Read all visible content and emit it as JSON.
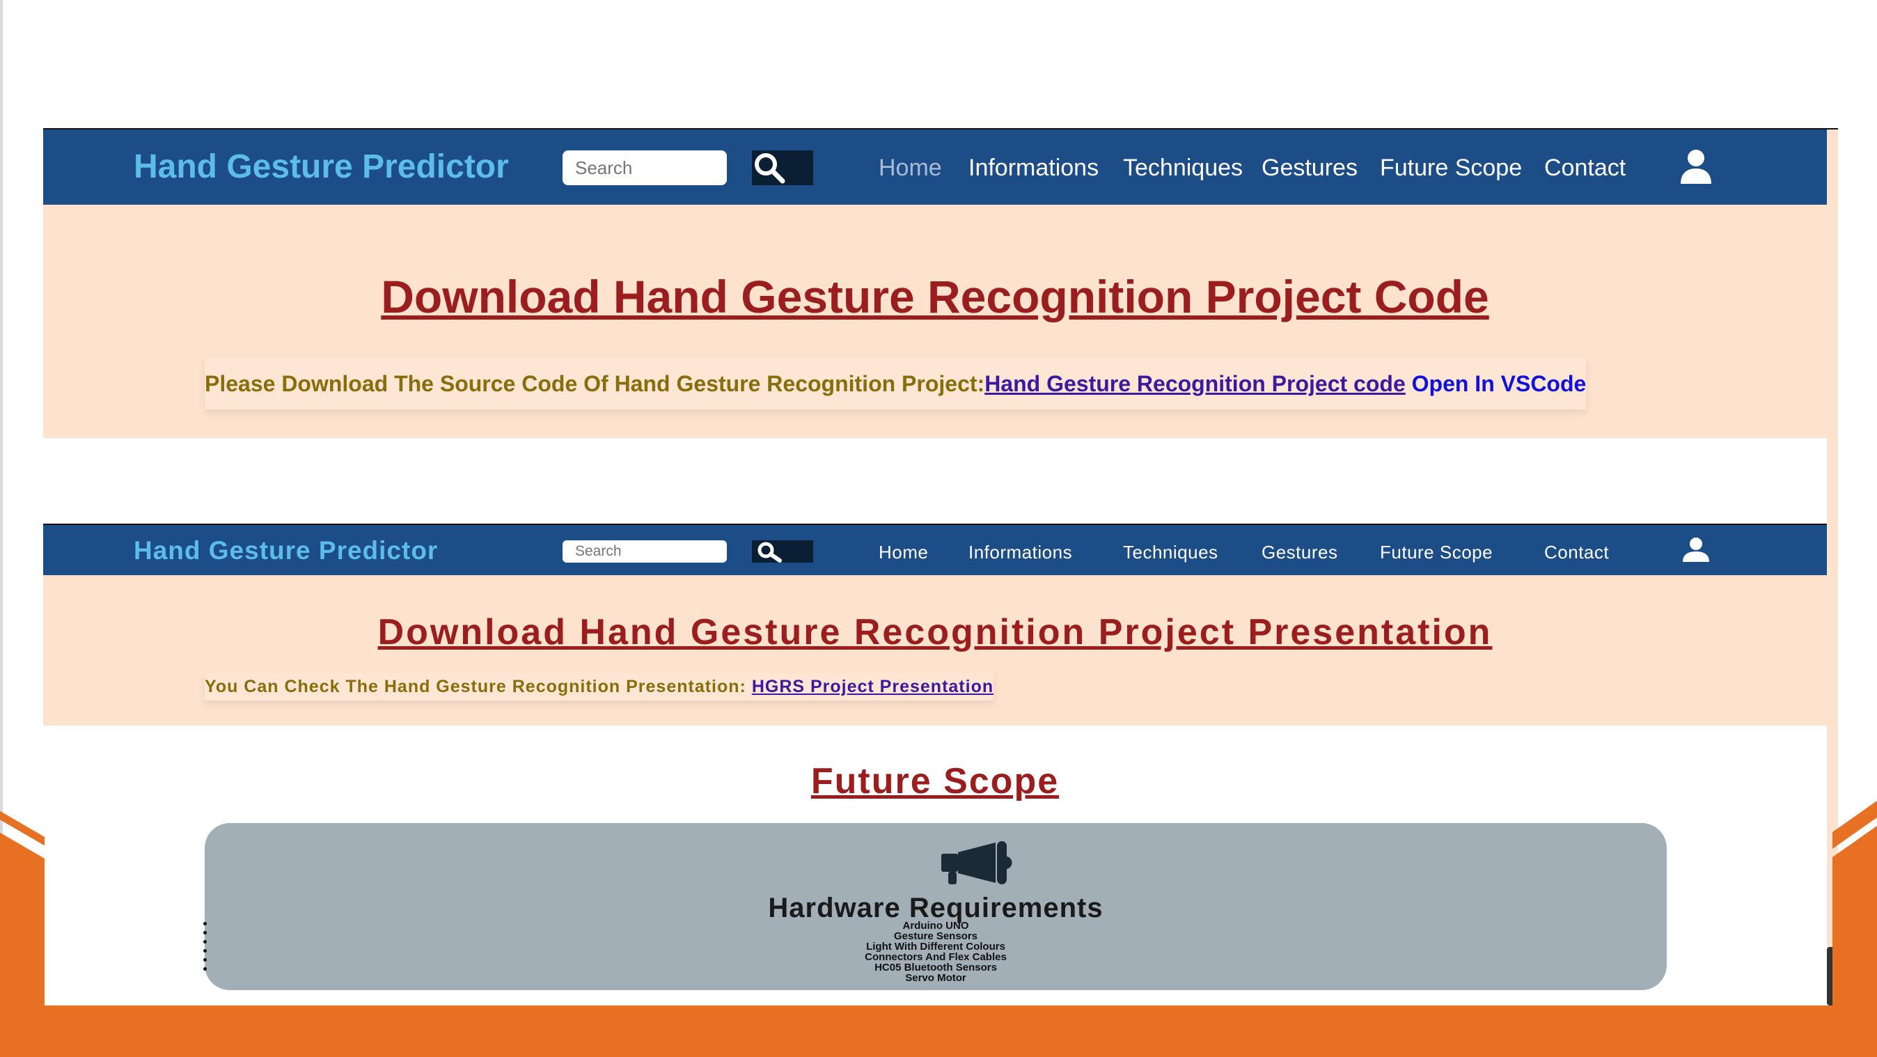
{
  "colors": {
    "nav_bg": "#1c4d87",
    "brand": "#5bbde8",
    "peach": "#fde3cd",
    "title_red": "#9b1d1d",
    "olive_text": "#8a6d0b",
    "link_purple": "#3b1aa0",
    "link_blue": "#1010e0",
    "card_gray": "#a2afb7",
    "slide_orange": "#e87022"
  },
  "navbar": {
    "brand": "Hand Gesture Predictor",
    "search_placeholder": "Search",
    "search_icon": "magnifier-icon",
    "user_icon": "user-icon",
    "links": [
      "Home",
      "Informations",
      "Techniques",
      "Gestures",
      "Future Scope",
      "Contact"
    ]
  },
  "code_section": {
    "title": "Download Hand Gesture Recognition Project Code",
    "text": "Please Download The Source Code Of Hand Gesture Recognition Project: ",
    "link": "Hand Gesture Recognition Project code",
    "vscode_link": " Open In VSCode"
  },
  "presentation_section": {
    "title": "Download Hand Gesture Recognition Project Presentation",
    "text": "You Can Check The Hand Gesture Recognition Presentation: ",
    "link": "HGRS Project Presentation"
  },
  "future_scope": {
    "title": "Future Scope",
    "card_icon": "megaphone-icon",
    "card_title": "Hardware Requirements",
    "items": [
      "Arduino UNO",
      "Gesture Sensors",
      "Light With Different Colours",
      "Connectors And Flex Cables",
      "HC05 Bluetooth Sensors",
      "Servo Motor"
    ]
  }
}
